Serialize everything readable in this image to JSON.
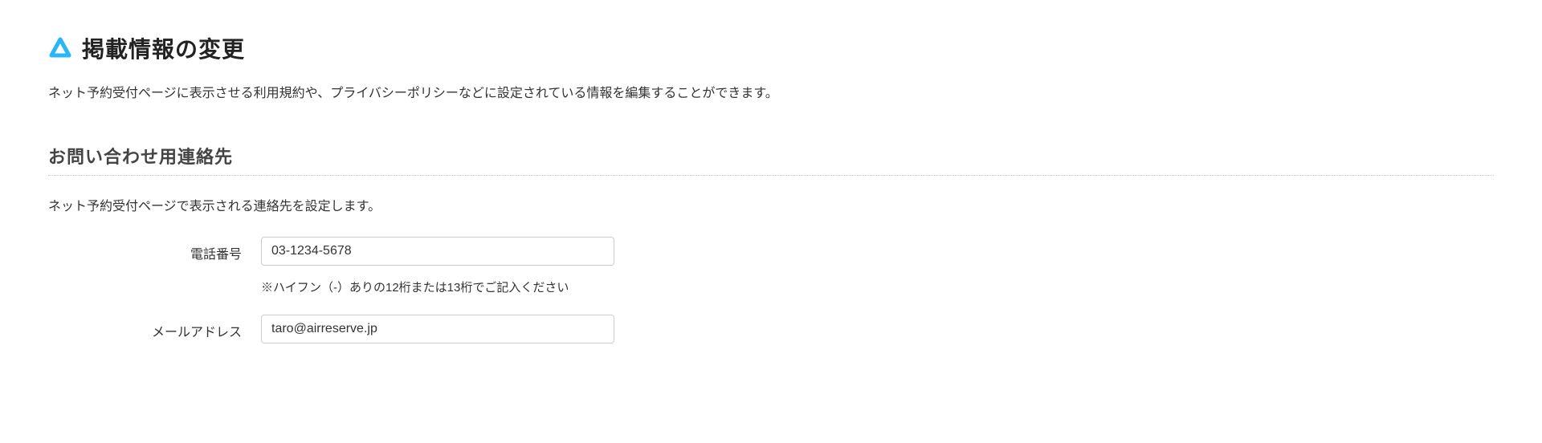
{
  "header": {
    "title": "掲載情報の変更",
    "description": "ネット予約受付ページに表示させる利用規約や、プライバシーポリシーなどに設定されている情報を編集することができます。"
  },
  "contactSection": {
    "title": "お問い合わせ用連絡先",
    "description": "ネット予約受付ページで表示される連絡先を設定します。",
    "fields": {
      "phone": {
        "label": "電話番号",
        "value": "03-1234-5678",
        "hint": "※ハイフン（-）ありの12桁または13桁でご記入ください"
      },
      "email": {
        "label": "メールアドレス",
        "value": "taro@airreserve.jp"
      }
    }
  },
  "colors": {
    "accent": "#29b6f6"
  }
}
